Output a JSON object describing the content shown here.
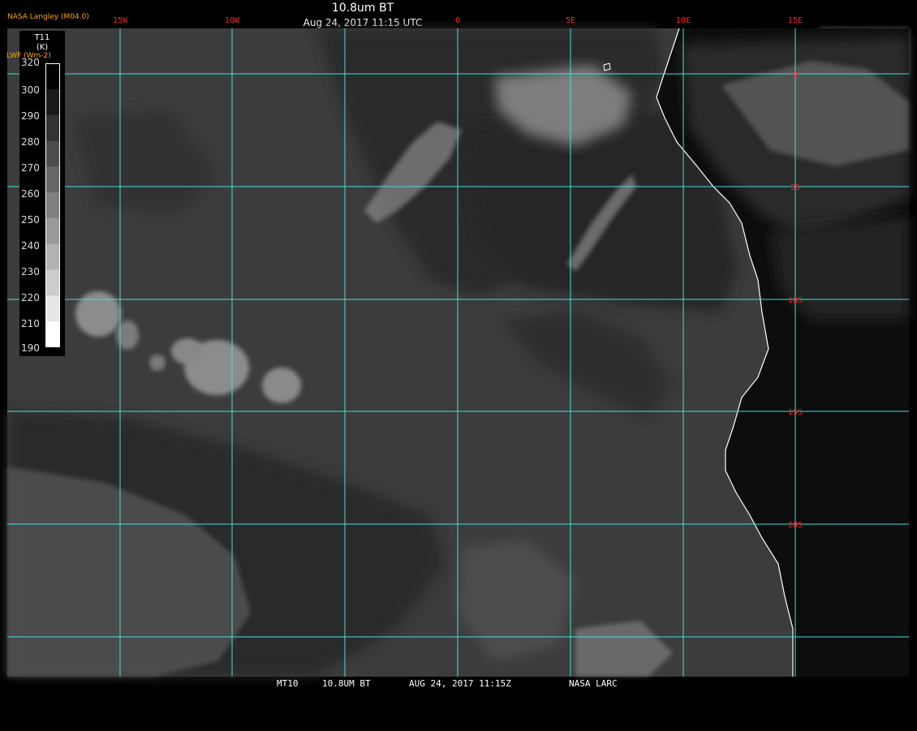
{
  "header": {
    "credit": "NASA Langley (M04.0)",
    "title": "10.8um BT",
    "subtitle": "Aug 24, 2017 11:15 UTC"
  },
  "colorbar": {
    "name": "T11",
    "unit": "(K)",
    "secondary_label": "LWF (Wm-2)",
    "ticks": [
      "320",
      "300",
      "290",
      "280",
      "270",
      "260",
      "250",
      "240",
      "230",
      "220",
      "210",
      "190"
    ],
    "gradient_from": "#000000",
    "gradient_to": "#ffffff"
  },
  "map": {
    "longitude_labels": [
      "15W",
      "10W",
      "0",
      "5E",
      "10E",
      "15E"
    ],
    "latitude_labels": [
      "0",
      "5S",
      "10S",
      "15S",
      "20S"
    ],
    "colors": {
      "grid": "#40e0e0",
      "graticule_label": "#ff2020",
      "coastline": "#ffffff",
      "ocean": "#3c3c3c",
      "land": "#0d0d0d"
    }
  },
  "footer": {
    "satellite": "MT10",
    "product": "10.8UM BT",
    "datetime": "AUG 24, 2017 11:15Z",
    "source": "NASA LARC"
  }
}
